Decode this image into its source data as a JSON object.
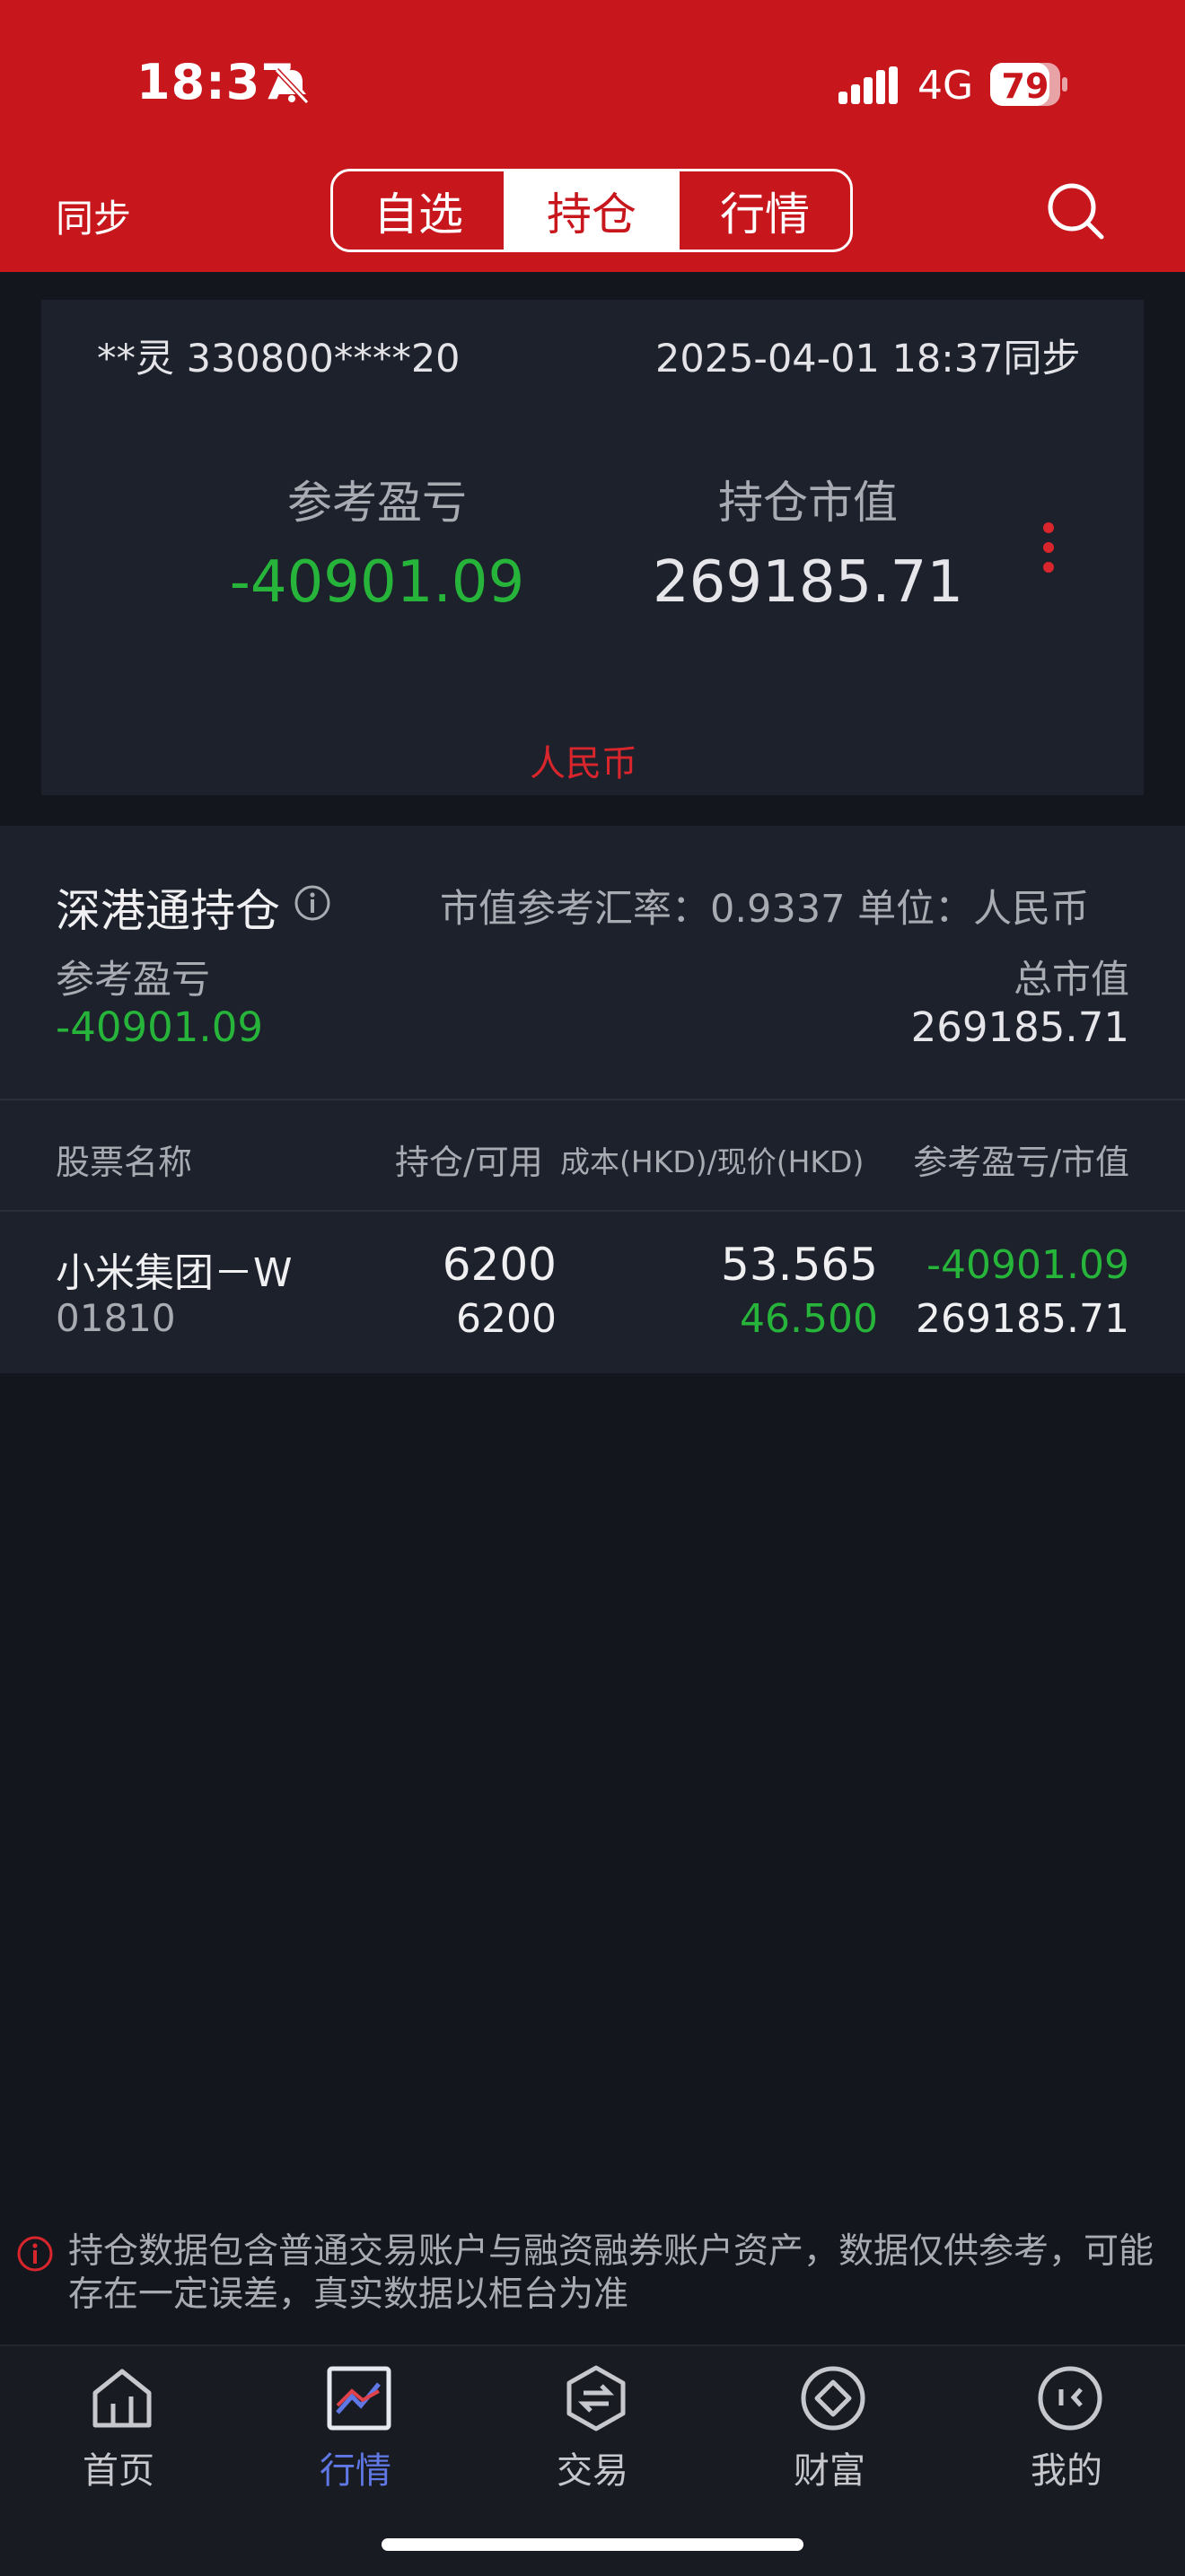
{
  "status_bar": {
    "time": "18:37",
    "network": "4G",
    "battery": "79"
  },
  "header": {
    "sync_label": "同步",
    "tabs": [
      "自选",
      "持仓",
      "行情"
    ],
    "active_tab": "持仓"
  },
  "summary": {
    "account": "**灵 330800****20",
    "sync_time": "2025-04-01 18:37同步",
    "pl_label": "参考盈亏",
    "pl_value": "-40901.09",
    "mv_label": "持仓市值",
    "mv_value": "269185.71",
    "currency": "人民币"
  },
  "section": {
    "title": "深港通持仓",
    "rate_text": "市值参考汇率：0.9337   单位：人民币",
    "pl_label": "参考盈亏",
    "pl_value": "-40901.09",
    "total_label": "总市值",
    "total_value": "269185.71"
  },
  "table": {
    "headers": {
      "name": "股票名称",
      "hold": "持仓/可用",
      "cost": "成本(HKD)/现价(HKD)",
      "pl": "参考盈亏/市值"
    },
    "rows": [
      {
        "name": "小米集团－W",
        "code": "01810",
        "hold": "6200",
        "available": "6200",
        "cost": "53.565",
        "price": "46.500",
        "pl": "-40901.09",
        "mv": "269185.71"
      }
    ]
  },
  "notice": "持仓数据包含普通交易账户与融资融券账户资产，数据仅供参考，可能存在一定误差，真实数据以柜台为准",
  "tabbar": [
    {
      "label": "首页",
      "icon": "home-icon"
    },
    {
      "label": "行情",
      "icon": "market-chart-icon"
    },
    {
      "label": "交易",
      "icon": "trade-exchange-icon"
    },
    {
      "label": "财富",
      "icon": "wealth-icon"
    },
    {
      "label": "我的",
      "icon": "profile-icon"
    }
  ],
  "colors": {
    "brand_red": "#c8161d",
    "loss_green": "#26b53a",
    "accent_blue": "#5f78e6"
  }
}
